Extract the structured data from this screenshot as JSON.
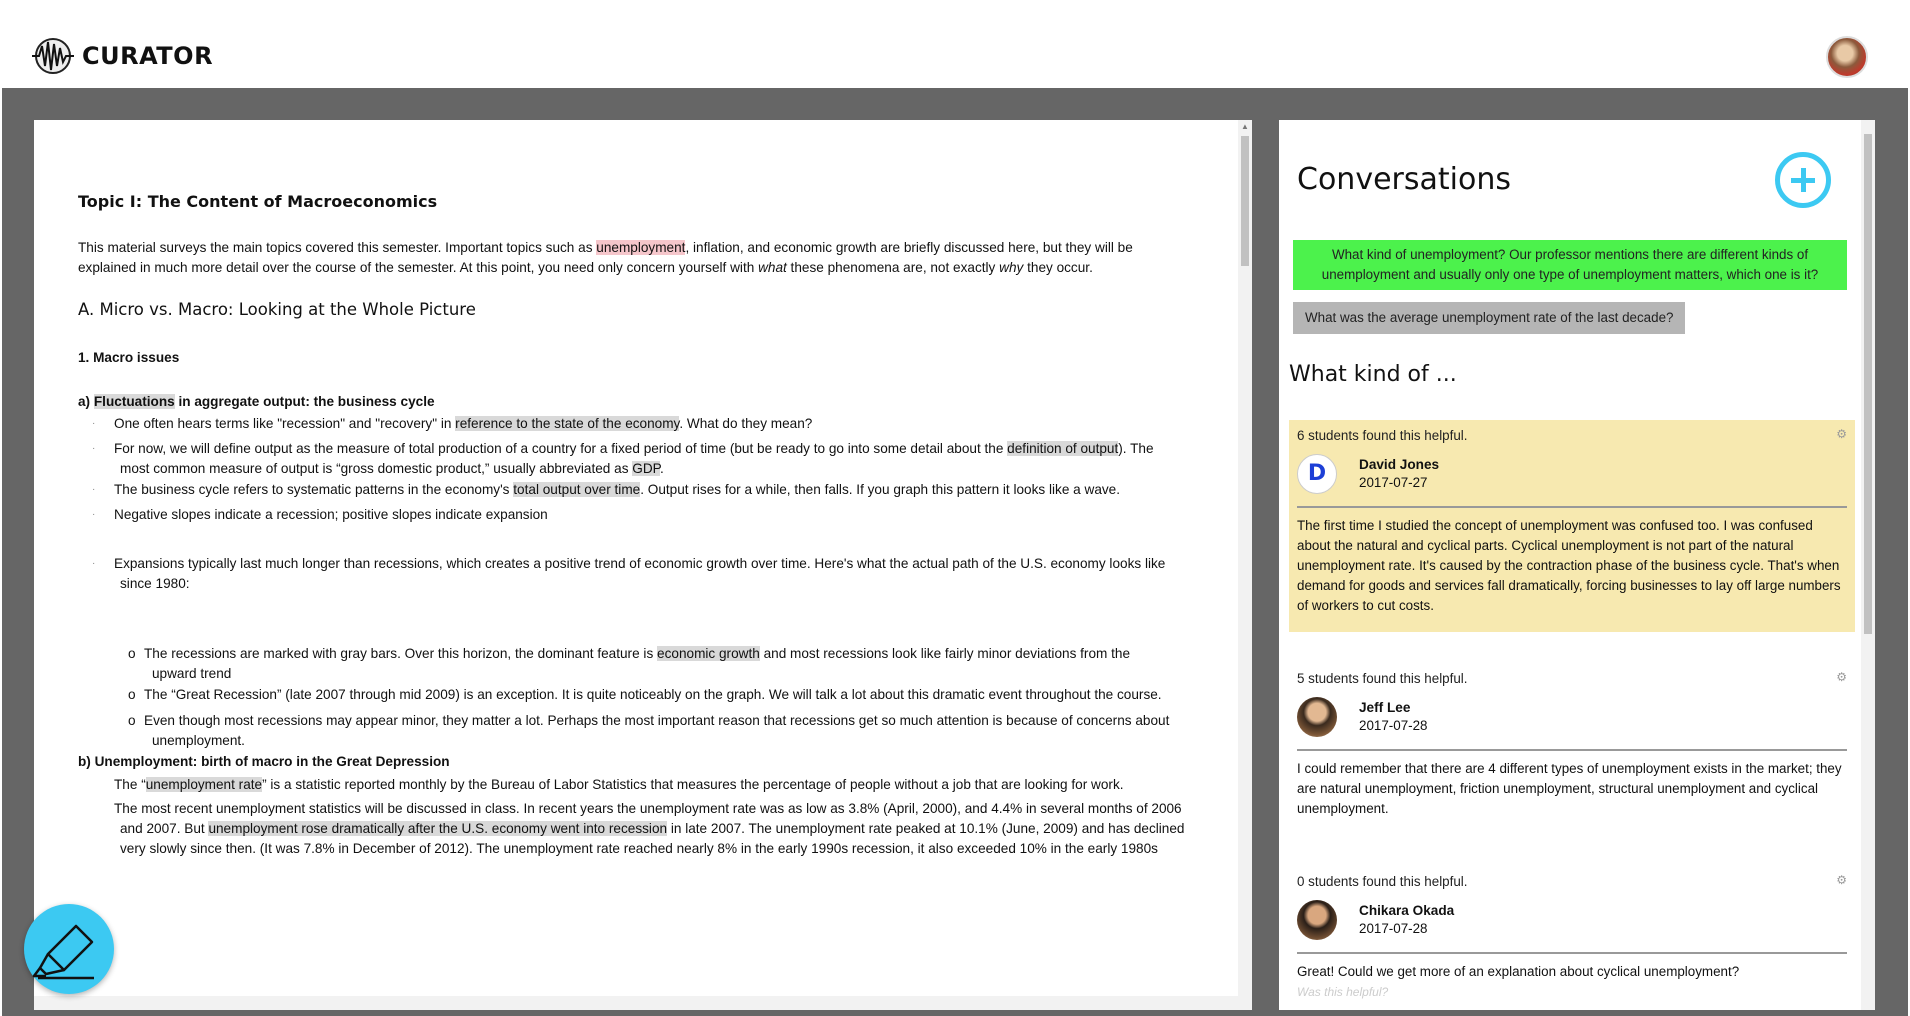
{
  "app": {
    "name": "CURATOR",
    "logo_icon": "brainwave-icon"
  },
  "user": {
    "avatar": "user-avatar"
  },
  "document": {
    "title": "Topic I:  The Content of Macroeconomics",
    "intro": {
      "pre": "This material surveys the main topics covered this semester.  Important topics such as ",
      "highlight": "unemployment",
      "post1": ", inflation, and economic growth are briefly discussed here, but they will be",
      "line2_pre": "explained in much more detail over the course of the semester.  At this point, you need only concern yourself with ",
      "what": "what",
      "line2_mid": " these phenomena are, not exactly ",
      "why": "why",
      "line2_post": " they occur."
    },
    "section_a": "A. Micro vs. Macro:  Looking at the Whole Picture",
    "section_1": "1. Macro issues",
    "sub_a": {
      "hl": "Fluctuations",
      "rest": " in aggregate output:  the business cycle",
      "prefix": "a) "
    },
    "bullets": {
      "b1_pre": "One often hears terms like \"recession\" and \"recovery\" in ",
      "b1_hl": "reference to the state of the economy",
      "b1_post": ".  What do they mean?",
      "b2_pre": "For now, we will define output as the measure of total production of a country for a fixed period of time (but be ready to go into some detail about the ",
      "b2_hl": "definition of output",
      "b2_post": ").  The",
      "b2_line2_pre": "most common measure of output is “gross domestic product,” usually abbreviated as ",
      "b2_line2_hl": "GDP",
      "b2_line2_post": ".",
      "b3_pre": "The business cycle refers to systematic patterns in the economy's ",
      "b3_hl": "total output over time",
      "b3_post": ".  Output rises for a while, then falls.  If you graph this pattern it looks like a wave.",
      "b4": "Negative slopes indicate a recession; positive slopes indicate expansion",
      "b5_line1": "Expansions typically last much longer than recessions, which creates a positive trend of economic growth over time.  Here's what the actual path of the U.S. economy looks like",
      "b5_line2": "since 1980:"
    },
    "subbullets": {
      "o_mark": "o",
      "s1_pre": "The recessions are marked with gray bars.  Over this horizon, the dominant feature is ",
      "s1_hl": "economic growth",
      "s1_post": " and most recessions look like fairly minor deviations from the",
      "s1_line2": "upward trend",
      "s2": "The “Great Recession” (late 2007 through mid 2009) is an exception.  It is quite noticeably on the graph.  We will talk a lot about this dramatic event throughout the course.",
      "s3_line1": "Even though most recessions may appear minor, they matter a lot.  Perhaps the most important reason that recessions get so much attention is because of concerns about",
      "s3_line2": "unemployment."
    },
    "sub_b": "b) Unemployment:  birth of macro in the Great Depression",
    "bullets_b": {
      "c1_pre": "The “",
      "c1_hl": "unemployment rate",
      "c1_post": "” is a statistic reported monthly by the Bureau of Labor Statistics that measures the percentage of people without a job that are looking for work.",
      "c2_line1": "The most recent unemployment statistics will be discussed in class.  In recent years the unemployment rate was as low as 3.8% (April, 2000), and 4.4% in several months of 2006",
      "c2_line2_pre": "and 2007.  But ",
      "c2_line2_hl": "unemployment rose dramatically after the U.S. economy went into recession",
      "c2_line2_post": " in late 2007.  The unemployment rate peaked at 10.1% (June, 2009) and has declined",
      "c2_line3": "very slowly since then.  (It was 7.8% in December of 2012).  The unemployment rate reached nearly 8% in the early 1990s recession, it also exceeded 10% in the early 1980s"
    },
    "bullet_mark": "·"
  },
  "conversations": {
    "title": "Conversations",
    "add_icon": "plus-circle-icon",
    "questions": [
      "What kind of unemployment? Our professor mentions there are different kinds of unemployment and usually only one type of unemployment matters, which one is it?",
      "What was the average unemployment rate of the last decade?"
    ],
    "thread_title": "What kind of ...",
    "answers": [
      {
        "helpful": "6 students found this helpful.",
        "initial": "D",
        "name": "David Jones",
        "date": "2017-07-27",
        "text": "The first time I studied the concept of unemployment was confused too. I was confused about the natural and cyclical parts. Cyclical unemployment is not part of the natural unemployment rate. It's caused by the contraction phase of the business cycle. That's when demand for goods and services fall dramatically, forcing businesses to lay off large numbers of workers to cut costs."
      },
      {
        "helpful": "5 students found this helpful.",
        "name": "Jeff Lee",
        "date": "2017-07-28",
        "text": "I could remember that there are 4 different types of unemployment exists in the market; they are natural unemployment, friction unemployment, structural unemployment and cyclical unemployment."
      },
      {
        "helpful": "0 students found this helpful.",
        "name": "Chikara Okada",
        "date": "2017-07-28",
        "text": "Great! Could we get more of an explanation about cyclical unemployment?",
        "footer": "Was this helpful?"
      }
    ]
  },
  "tools": {
    "highlighter_icon": "highlighter-pen-icon"
  },
  "colors": {
    "accent": "#3cc9f2",
    "active_question": "#4cf24c",
    "top_answer": "#f7e9b0",
    "highlight": "#d9d9d9",
    "highlight_red": "#f5c6cb"
  }
}
